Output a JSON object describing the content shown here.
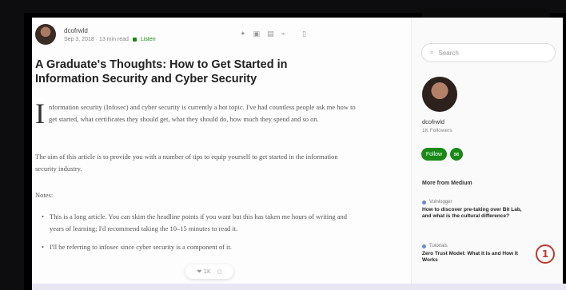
{
  "author": {
    "name": "dcofrwld",
    "meta": "Sep 3, 2018 · 13 min read",
    "member_label": "Listen"
  },
  "share_icons": [
    "twitter-icon",
    "linkedin-icon",
    "facebook-icon",
    "link-icon",
    "bookmark-icon"
  ],
  "article": {
    "title": "A Graduate's Thoughts: How to Get Started in Information Security and Cyber Security",
    "dropcap": "I",
    "p1": "nformation security (Infosec) and cyber security is currently a hot topic. I've had countless people ask me how to get started, what certificates they should get, what they should do, how much they spend and so on.",
    "p2": "The aim of this article is to provide you with a number of tips to equip yourself to get started in the information security industry.",
    "p3": "Notes:",
    "list": [
      "This is a long article. You can skim the headline points if you want but this has taken me hours of writing and years of learning; I'd recommend taking the 10–15 minutes to read it.",
      "I'll be referring to infosec since cyber security is a component of it."
    ]
  },
  "floating_bar": {
    "claps": "❤ 1K",
    "comments": "○"
  },
  "sidebar": {
    "search_placeholder": "Search",
    "profile_name": "dcofrwld",
    "followers": "1K Followers",
    "follow_label": "Follow",
    "more_heading": "More from Medium",
    "recommendations": [
      {
        "author": "Vulnlogger",
        "title": "How to discover pre-taking over Bit Lab, and what is the cultural difference?"
      },
      {
        "author": "Tutorials",
        "title": "Zero Trust Model: What It Is and How It Works"
      }
    ]
  },
  "badge": "1",
  "colors": {
    "accent_green": "#1a8917",
    "badge_red": "#c0392b"
  }
}
